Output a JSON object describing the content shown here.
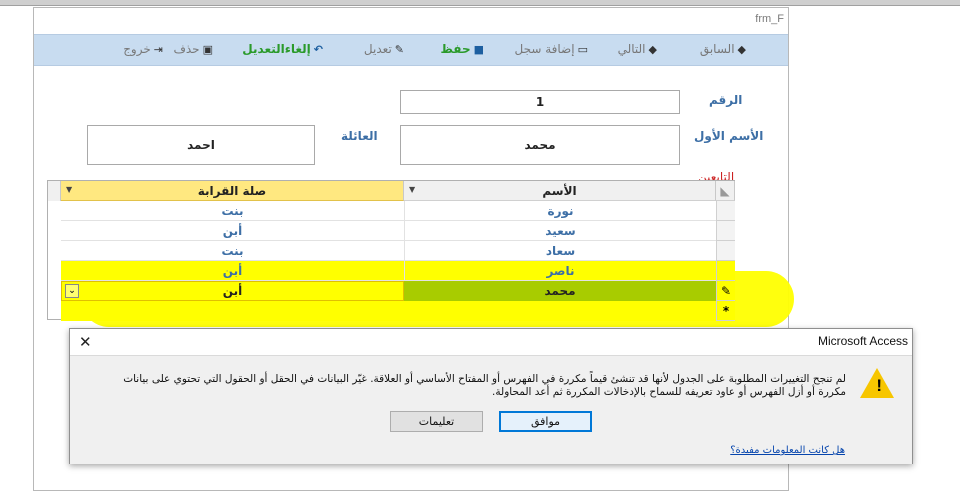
{
  "form": {
    "title": "frm_F",
    "toolbar": {
      "previous": "السابق",
      "next": "التالي",
      "add_record": "إضافة سجل",
      "save": "حفظ",
      "edit": "تعديل",
      "cancel_edit": "إلغاءالتعديل",
      "delete": "حذف",
      "exit": "خروج"
    },
    "number_label": "الرقم",
    "number_value": "1",
    "first_name_label": "الأسم الأول",
    "first_name_value": "محمد",
    "family_label": "العائلة",
    "family_value": "احمد",
    "dependents_label": "التابعين"
  },
  "grid": {
    "columns": [
      "الأسم",
      "صلة القرابة"
    ],
    "rows": [
      {
        "name": "نورة",
        "relation": "بنت"
      },
      {
        "name": "سعيد",
        "relation": "أبن"
      },
      {
        "name": "سعاد",
        "relation": "بنت"
      },
      {
        "name": "ناصر",
        "relation": "أبن"
      },
      {
        "name": "محمد",
        "relation": "أبن"
      }
    ],
    "edit_marker": "✎",
    "new_marker": "*",
    "colors": {
      "active_row_name_bg": "#a8cc00",
      "active_row_relation_bg": "#ffff00",
      "name_text": "#3d6fa6",
      "relation_text": "#3d6fa6"
    }
  },
  "dialog": {
    "title": "Microsoft Access",
    "message_line1": "لم تنجح التغييرات المطلوبة على الجدول لأنها قد تنشئ قيماً مكررة في الفهرس أو المفتاح الأساسي أو العلاقة. غيّر البيانات في الحقل أو الحقول التي تحتوي على بيانات",
    "message_line2": "مكررة أو أزل الفهرس أو عاود تعريفه للسماح بالإدخالات المكررة ثم أعد المحاولة.",
    "ok_label": "موافق",
    "help_label": "تعليمات",
    "link_text": "هل كانت المعلومات مفيدة؟"
  }
}
